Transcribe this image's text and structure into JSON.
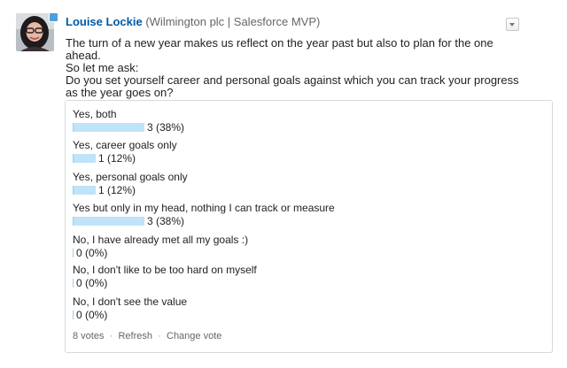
{
  "post": {
    "author": {
      "name": "Louise Lockie",
      "meta": "(Wilmington plc | Salesforce MVP)"
    },
    "menu_icon": "dropdown-triangle",
    "body_lines": [
      "The turn of a new year makes us reflect on the year past but also to plan for the one ahead.",
      "So let me ask:",
      "Do you set yourself career and personal goals against which you can track your progress as the year goes on?"
    ]
  },
  "poll": {
    "bar_color": "#bfe3f8",
    "choices": [
      {
        "label": "Yes, both",
        "result": "3 (38%)",
        "fraction": 0.38
      },
      {
        "label": "Yes, career goals only",
        "result": "1 (12%)",
        "fraction": 0.12
      },
      {
        "label": "Yes, personal goals only",
        "result": "1 (12%)",
        "fraction": 0.12
      },
      {
        "label": "Yes but only in my head, nothing I can track or measure",
        "result": "3 (38%)",
        "fraction": 0.38
      },
      {
        "label": "No, I have already met all my goals :)",
        "result": "0 (0%)",
        "fraction": 0
      },
      {
        "label": "No, I don't like to be too hard on myself",
        "result": "0 (0%)",
        "fraction": 0
      },
      {
        "label": "No, I don't see the value",
        "result": "0 (0%)",
        "fraction": 0
      }
    ],
    "footer": {
      "votes": "8 votes",
      "separator": "·",
      "refresh": "Refresh",
      "change_vote": "Change vote"
    }
  }
}
